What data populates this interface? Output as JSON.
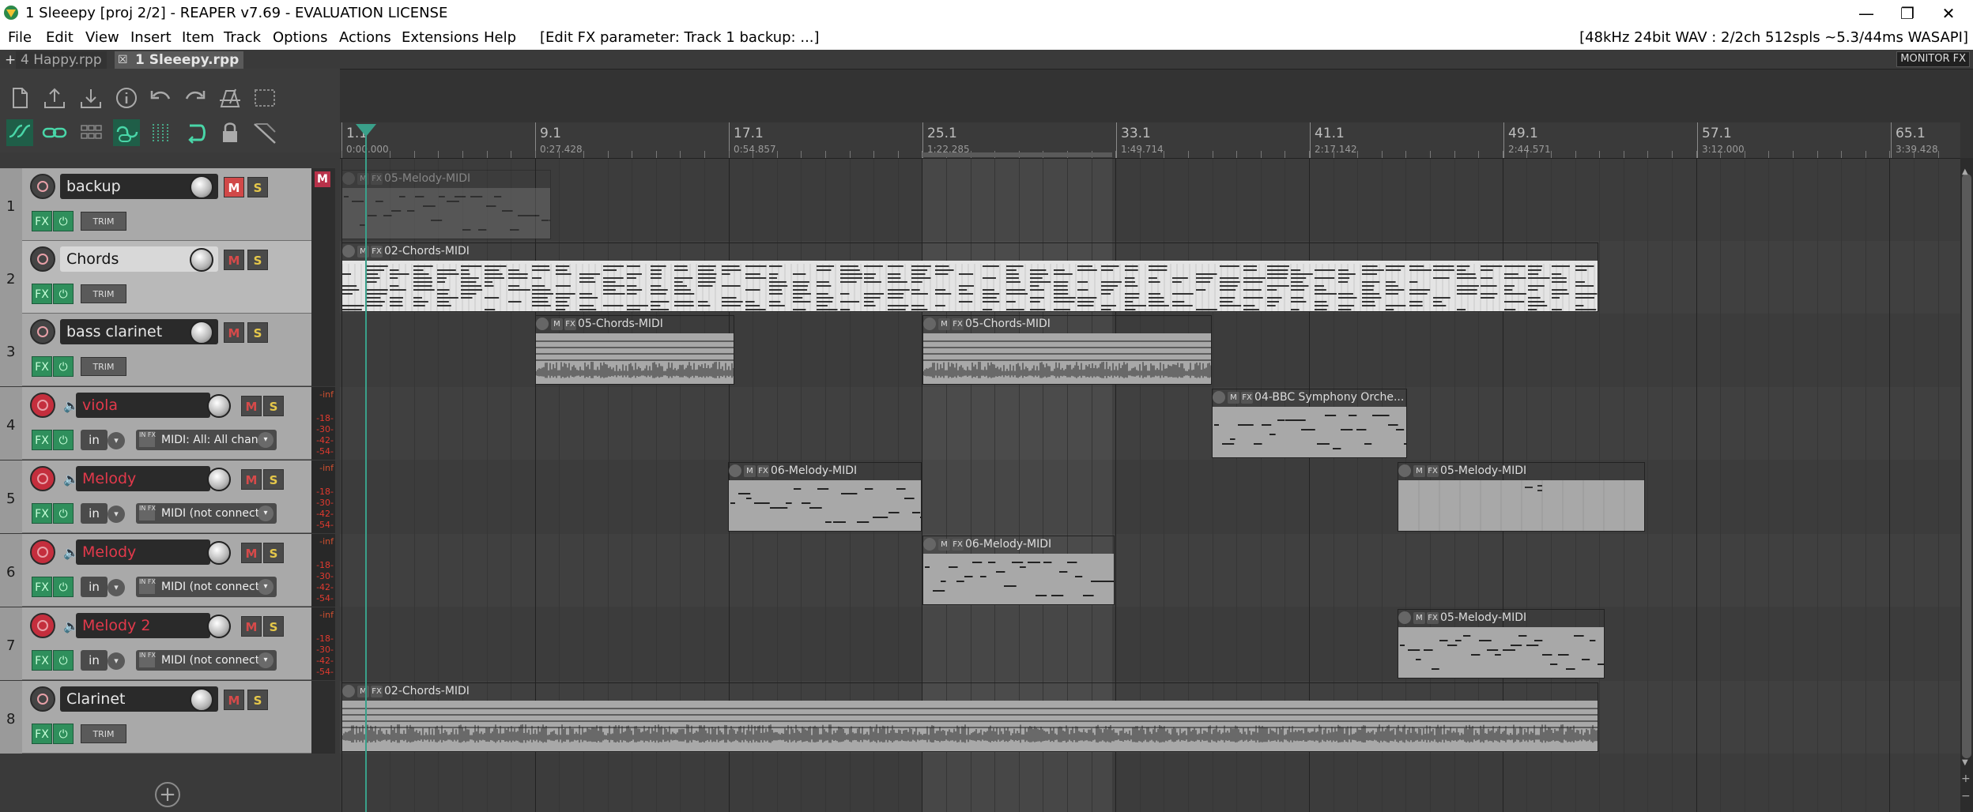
{
  "window": {
    "title": "1 Sleeepy [proj 2/2] - REAPER v7.69 - EVALUATION LICENSE",
    "controls": [
      "—",
      "❐",
      "✕"
    ]
  },
  "menu": {
    "items": [
      "File",
      "Edit",
      "View",
      "Insert",
      "Item",
      "Track",
      "Options",
      "Actions",
      "Extensions",
      "Help"
    ],
    "status": "[Edit FX parameter: Track 1 backup: ...]",
    "audio_info": "[48kHz 24bit WAV : 2/2ch 512spls ~5.3/44ms WASAPI]"
  },
  "tabs": {
    "add": "+",
    "items": [
      {
        "label": "4 Happy.rpp",
        "active": false
      },
      {
        "label": "1 Sleeepy.rpp",
        "active": true
      }
    ],
    "close": "☒",
    "monitor_fx": "MONITOR FX"
  },
  "toolbar": {
    "row1": [
      "new-project-icon",
      "open-project-icon",
      "save-project-icon",
      "info-icon",
      "undo-icon",
      "redo-icon",
      "metronome-icon",
      "grid-icon"
    ],
    "row2": [
      "ripple-edit-icon",
      "link-icon",
      "snap-grid-icon",
      "loop-link-icon",
      "grid-lines-icon",
      "loop-icon",
      "lock-icon",
      "envelope-icon"
    ]
  },
  "ruler": {
    "marks": [
      {
        "bar": "1.1",
        "time": "0:00.000"
      },
      {
        "bar": "9.1",
        "time": "0:27.428"
      },
      {
        "bar": "17.1",
        "time": "0:54.857"
      },
      {
        "bar": "25.1",
        "time": "1:22.285"
      },
      {
        "bar": "33.1",
        "time": "1:49.714"
      },
      {
        "bar": "41.1",
        "time": "2:17.142"
      },
      {
        "bar": "49.1",
        "time": "2:44.571"
      },
      {
        "bar": "57.1",
        "time": "3:12.000"
      },
      {
        "bar": "65.1",
        "time": "3:39.428"
      }
    ]
  },
  "labels": {
    "m": "M",
    "s": "S",
    "fx": "FX",
    "power": "⏻",
    "trim": "TRIM",
    "in": "in",
    "infx": "IN FX",
    "dropdown": "▾",
    "master_m": "M",
    "add": "+",
    "speaker": "🔈"
  },
  "tracks": [
    {
      "num": "1",
      "name": "backup",
      "type": "audio",
      "muted": true,
      "armed": false,
      "style": "dark"
    },
    {
      "num": "2",
      "name": "Chords",
      "type": "audio",
      "muted": false,
      "armed": false,
      "style": "light"
    },
    {
      "num": "3",
      "name": "bass clarinet",
      "type": "audio",
      "muted": false,
      "armed": false,
      "style": "dark"
    },
    {
      "num": "4",
      "name": "viola",
      "type": "midi",
      "muted": false,
      "armed": true,
      "style": "red",
      "midi_input": "MIDI: All: All chan"
    },
    {
      "num": "5",
      "name": "Melody",
      "type": "midi",
      "muted": false,
      "armed": true,
      "style": "red",
      "midi_input": "MIDI (not connect"
    },
    {
      "num": "6",
      "name": "Melody",
      "type": "midi",
      "muted": false,
      "armed": true,
      "style": "red",
      "midi_input": "MIDI (not connect"
    },
    {
      "num": "7",
      "name": "Melody 2",
      "type": "midi",
      "muted": false,
      "armed": true,
      "style": "red",
      "midi_input": "MIDI (not connect"
    },
    {
      "num": "8",
      "name": "Clarinet",
      "type": "audio",
      "muted": false,
      "armed": false,
      "style": "dark"
    }
  ],
  "meter_labels": [
    "-inf",
    "-18-",
    "-30-",
    "-42-",
    "-54-"
  ],
  "items": [
    {
      "track": 1,
      "name": "05-Melody-MIDI"
    },
    {
      "track": 2,
      "name": "02-Chords-MIDI"
    },
    {
      "track": 3,
      "name": "05-Chords-MIDI"
    },
    {
      "track": 3,
      "name": "05-Chords-MIDI"
    },
    {
      "track": 4,
      "name": "04-BBC Symphony Orche..."
    },
    {
      "track": 5,
      "name": "06-Melody-MIDI"
    },
    {
      "track": 5,
      "name": "05-Melody-MIDI"
    },
    {
      "track": 6,
      "name": "06-Melody-MIDI"
    },
    {
      "track": 7,
      "name": "05-Melody-MIDI"
    },
    {
      "track": 8,
      "name": "02-Chords-MIDI"
    }
  ],
  "colors": {
    "record_armed": "#c42e3d",
    "mute_on": "#d14848",
    "fx_green": "#2f8f5c",
    "item_fill": "#a8a8a8",
    "playhead": "#3aa08a"
  }
}
